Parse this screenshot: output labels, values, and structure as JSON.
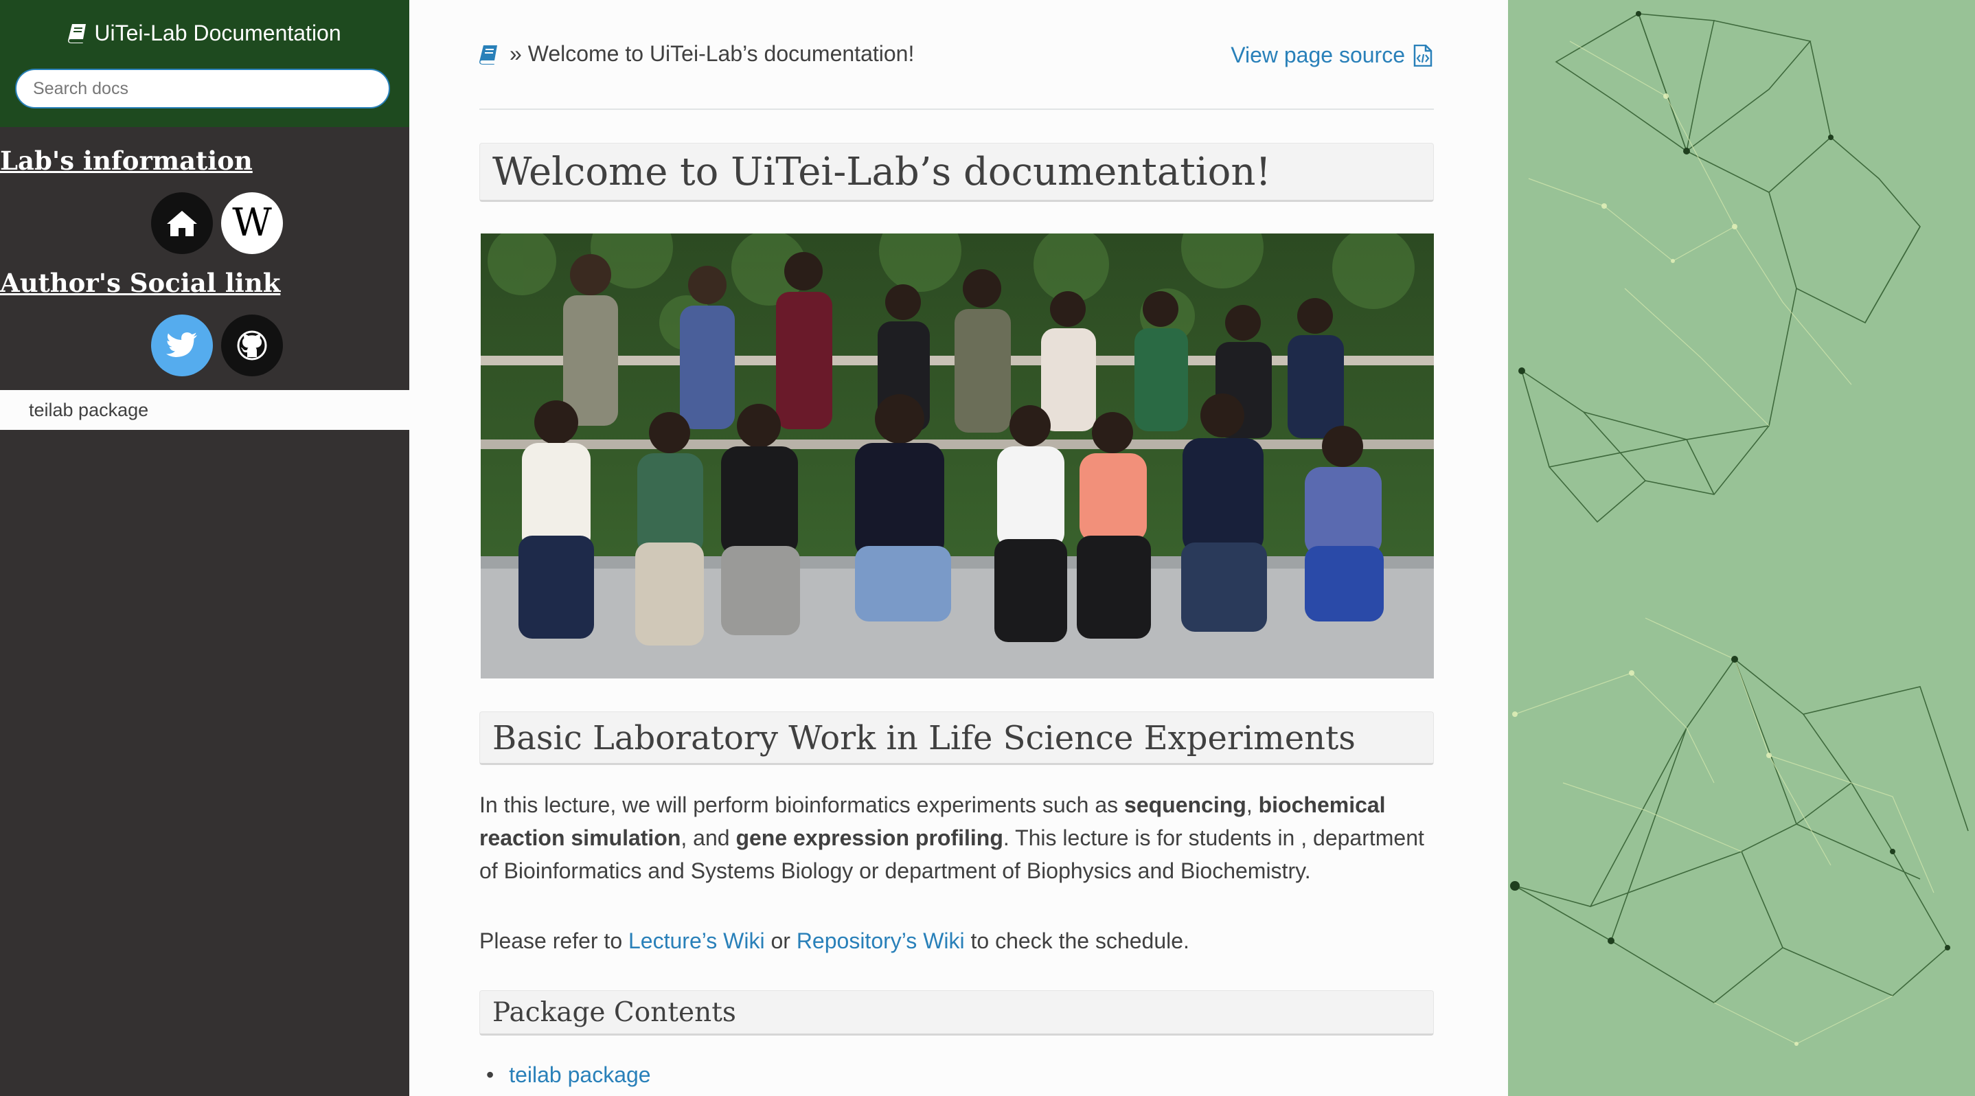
{
  "sidebar": {
    "project_title": "UiTei-Lab Documentation",
    "search_placeholder": "Search docs",
    "lab_heading": "Lab's information",
    "lab_icons": [
      "home-icon",
      "wikipedia-icon"
    ],
    "social_heading": "Author's Social link",
    "social_icons": [
      "twitter-icon",
      "github-icon"
    ],
    "current_item": "teilab package"
  },
  "breadcrumb": {
    "separator": "»",
    "current": "Welcome to UiTei-Lab’s documentation!"
  },
  "view_source": "View page source",
  "page_title": "Welcome to UiTei-Lab’s documentation!",
  "section": {
    "title": "Basic Laboratory Work in Life Science Experiments",
    "p1": {
      "t1": "In this lecture, we will perform bioinformatics experiments such as ",
      "b1": "sequencing",
      "t2": ", ",
      "b2": "biochemical reaction simulation",
      "t3": ", and ",
      "b3": "gene expression profiling",
      "t4": ". This lecture is for students in , department of Bioinformatics and Systems Biology or department of Biophysics and Biochemistry."
    },
    "p2": {
      "t1": "Please refer to ",
      "link1": "Lecture’s Wiki",
      "t2": " or ",
      "link2": "Repository’s Wiki",
      "t3": " to check the schedule."
    }
  },
  "package_contents": {
    "title": "Package Contents",
    "items": [
      "teilab package"
    ]
  },
  "colors": {
    "sidebar_bg": "#343131",
    "sidebar_top": "#1e4a1f",
    "link": "#2980b9",
    "twitter": "#55acee",
    "background": "#98c296"
  }
}
